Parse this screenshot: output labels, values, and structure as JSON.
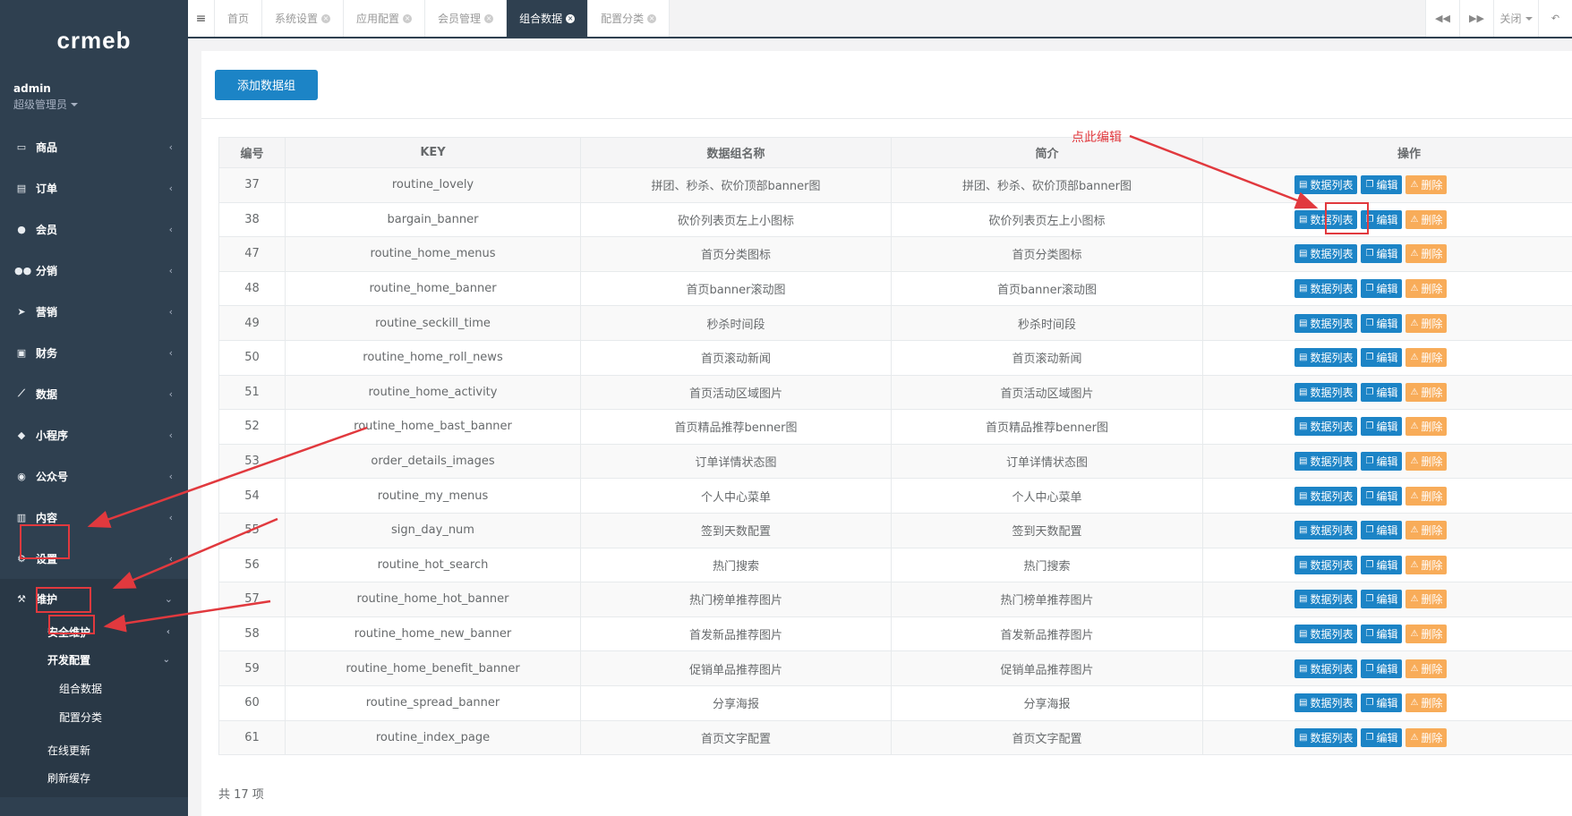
{
  "sidebar": {
    "logo": "crmeb",
    "user": {
      "name": "admin",
      "role": "超级管理员"
    },
    "menu": [
      {
        "label": "商品",
        "icon": "monitor-icon"
      },
      {
        "label": "订单",
        "icon": "clipboard-icon"
      },
      {
        "label": "会员",
        "icon": "user-icon"
      },
      {
        "label": "分销",
        "icon": "users-icon"
      },
      {
        "label": "营销",
        "icon": "send-icon"
      },
      {
        "label": "财务",
        "icon": "money-icon"
      },
      {
        "label": "数据",
        "icon": "line-chart-icon"
      },
      {
        "label": "小程序",
        "icon": "cubes-icon"
      },
      {
        "label": "公众号",
        "icon": "wechat-icon"
      },
      {
        "label": "内容",
        "icon": "book-icon"
      },
      {
        "label": "设置",
        "icon": "gear-icon"
      },
      {
        "label": "维护",
        "icon": "wrench-icon"
      }
    ],
    "submenu": {
      "security": "安全维护",
      "dev_config": "开发配置",
      "group_data": "组合数据",
      "config_category": "配置分类",
      "online_update": "在线更新",
      "refresh_cache": "刷新缓存"
    }
  },
  "tabs": [
    {
      "label": "首页"
    },
    {
      "label": "系统设置"
    },
    {
      "label": "应用配置"
    },
    {
      "label": "会员管理"
    },
    {
      "label": "组合数据",
      "active": true
    },
    {
      "label": "配置分类"
    }
  ],
  "tabbar": {
    "close_label": "关闭"
  },
  "toolbar": {
    "add_label": "添加数据组"
  },
  "table": {
    "headers": [
      "编号",
      "KEY",
      "数据组名称",
      "简介",
      "操作"
    ],
    "ops": {
      "list": "数据列表",
      "edit": "编辑",
      "delete": "删除"
    },
    "rows": [
      {
        "id": "37",
        "key": "routine_lovely",
        "name": "拼团、秒杀、砍价顶部banner图",
        "intro": "拼团、秒杀、砍价顶部banner图"
      },
      {
        "id": "38",
        "key": "bargain_banner",
        "name": "砍价列表页左上小图标",
        "intro": "砍价列表页左上小图标"
      },
      {
        "id": "47",
        "key": "routine_home_menus",
        "name": "首页分类图标",
        "intro": "首页分类图标"
      },
      {
        "id": "48",
        "key": "routine_home_banner",
        "name": "首页banner滚动图",
        "intro": "首页banner滚动图"
      },
      {
        "id": "49",
        "key": "routine_seckill_time",
        "name": "秒杀时间段",
        "intro": "秒杀时间段"
      },
      {
        "id": "50",
        "key": "routine_home_roll_news",
        "name": "首页滚动新闻",
        "intro": "首页滚动新闻"
      },
      {
        "id": "51",
        "key": "routine_home_activity",
        "name": "首页活动区域图片",
        "intro": "首页活动区域图片"
      },
      {
        "id": "52",
        "key": "routine_home_bast_banner",
        "name": "首页精品推荐benner图",
        "intro": "首页精品推荐benner图"
      },
      {
        "id": "53",
        "key": "order_details_images",
        "name": "订单详情状态图",
        "intro": "订单详情状态图"
      },
      {
        "id": "54",
        "key": "routine_my_menus",
        "name": "个人中心菜单",
        "intro": "个人中心菜单"
      },
      {
        "id": "55",
        "key": "sign_day_num",
        "name": "签到天数配置",
        "intro": "签到天数配置"
      },
      {
        "id": "56",
        "key": "routine_hot_search",
        "name": "热门搜索",
        "intro": "热门搜索"
      },
      {
        "id": "57",
        "key": "routine_home_hot_banner",
        "name": "热门榜单推荐图片",
        "intro": "热门榜单推荐图片"
      },
      {
        "id": "58",
        "key": "routine_home_new_banner",
        "name": "首发新品推荐图片",
        "intro": "首发新品推荐图片"
      },
      {
        "id": "59",
        "key": "routine_home_benefit_banner",
        "name": "促销单品推荐图片",
        "intro": "促销单品推荐图片"
      },
      {
        "id": "60",
        "key": "routine_spread_banner",
        "name": "分享海报",
        "intro": "分享海报"
      },
      {
        "id": "61",
        "key": "routine_index_page",
        "name": "首页文字配置",
        "intro": "首页文字配置"
      }
    ],
    "footer": "共 17 项"
  },
  "annotation": {
    "note": "点此编辑",
    "color": "#e1393e"
  },
  "colors": {
    "sidebar": "#2f4050",
    "primary": "#1c84c6",
    "warning": "#f8ac59"
  }
}
